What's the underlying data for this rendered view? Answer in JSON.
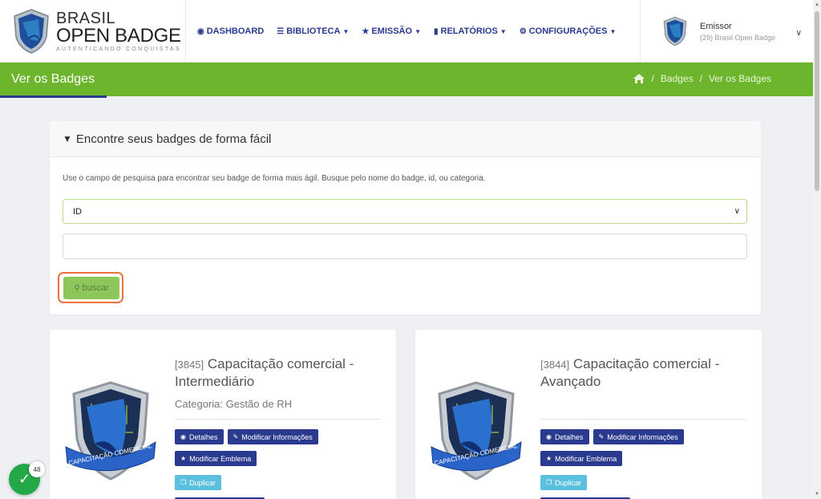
{
  "brand": {
    "line1": "BRASIL",
    "line2": "OPEN BADGE",
    "line3": "AUTENTICANDO CONQUISTAS"
  },
  "nav": {
    "items": [
      {
        "label": "DASHBOARD",
        "icon": "tachometer-icon"
      },
      {
        "label": "BIBLIOTECA",
        "icon": "database-icon"
      },
      {
        "label": "EMISSÃO",
        "icon": "trophy-icon"
      },
      {
        "label": "RELATÓRIOS",
        "icon": "book-icon"
      },
      {
        "label": "CONFIGURAÇÕES",
        "icon": "cogs-icon"
      }
    ]
  },
  "user": {
    "role": "Emissor",
    "org": "(29) Brasil Open Badge"
  },
  "page": {
    "title": "Ver os Badges",
    "breadcrumb": [
      "Badges",
      "Ver os Badges"
    ]
  },
  "search": {
    "heading": "Encontre seus badges de forma fácil",
    "help": "Use o campo de pesquisa para encontrar seu badge de forma mais ágil. Busque pelo nome do badge, id, ou categoria.",
    "select_value": "ID",
    "input_value": "",
    "button_label": "buscar"
  },
  "badges": [
    {
      "id": "[3845]",
      "title_line1": "Capacitação comercial -",
      "title_line2": "Intermediário",
      "category": "Categoria: Gestão de RH",
      "ribbon": "CAPACITAÇÃO COMERCIAL"
    },
    {
      "id": "[3844]",
      "title_line1": "Capacitação comercial -",
      "title_line2": "Avançado",
      "category": "",
      "ribbon": "CAPACITAÇÃO COMERCIAL"
    }
  ],
  "actions": {
    "details": "Detalhes",
    "modify_info": "Modificar Informações",
    "modify_emblem": "Modificar Emblema",
    "duplicate": "Duplicar"
  },
  "widget": {
    "count": "48"
  },
  "colors": {
    "primary": "#2a3a8f",
    "green": "#6cb52d",
    "info": "#5bc0de",
    "highlight": "#e8743b"
  }
}
